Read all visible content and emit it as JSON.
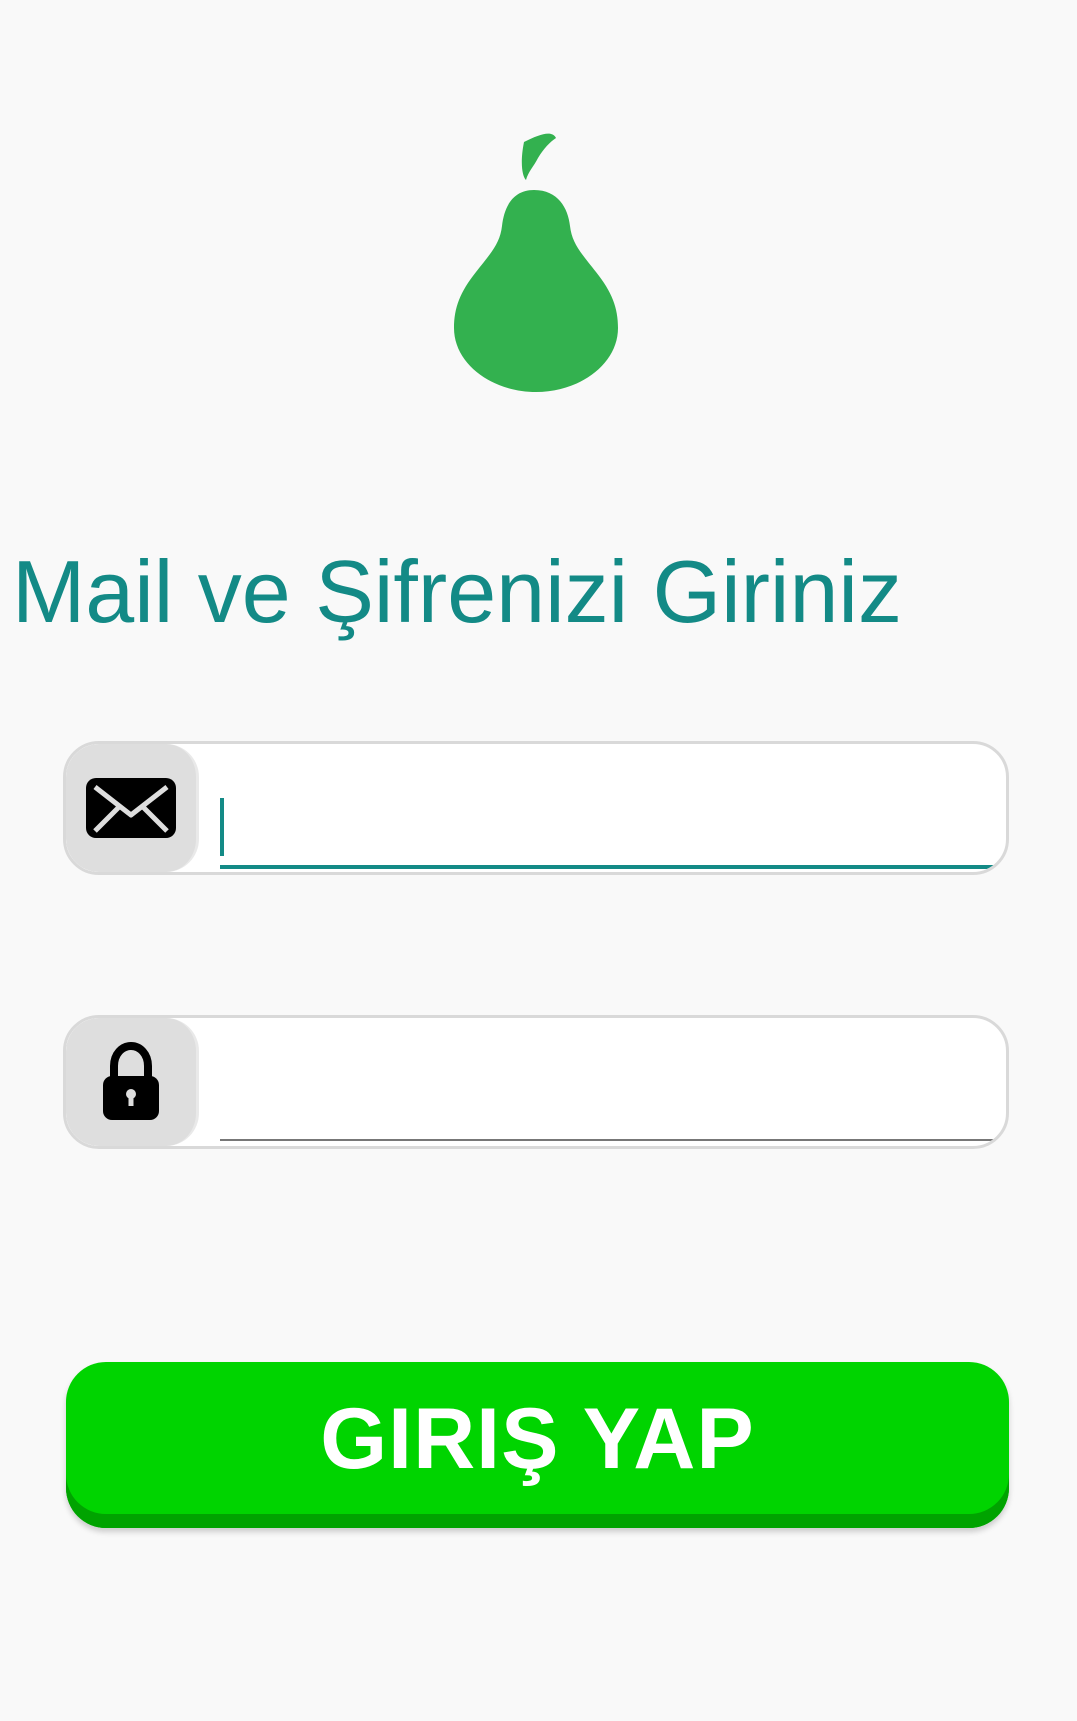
{
  "logo": {
    "icon": "pear-icon",
    "color": "#33b14f"
  },
  "heading": {
    "text": "Mail ve Şifrenizi Giriniz",
    "color": "#138a86"
  },
  "form": {
    "email": {
      "icon": "envelope-icon",
      "value": "",
      "placeholder": "",
      "focused": true
    },
    "password": {
      "icon": "lock-icon",
      "value": "",
      "placeholder": "",
      "focused": false
    }
  },
  "login_button": {
    "label": "GIRIŞ YAP",
    "color": "#00d400"
  },
  "colors": {
    "background": "#f9f9f9",
    "accent": "#138a86"
  }
}
